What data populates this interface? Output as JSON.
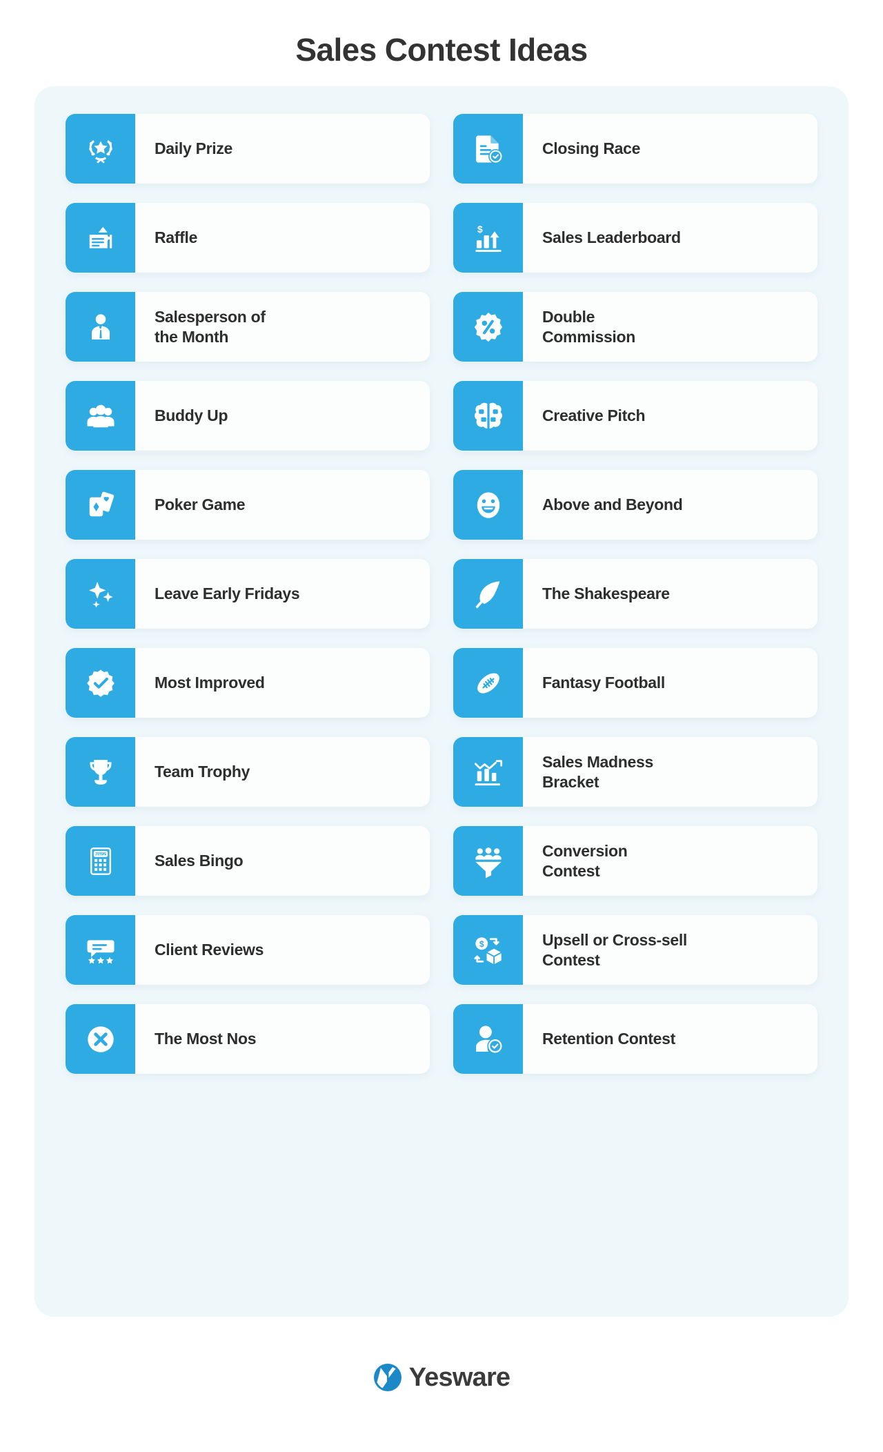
{
  "header": {
    "title": "Sales Contest Ideas"
  },
  "theme": {
    "page_background": "#ffffff",
    "panel_background": "#eef7fa",
    "card_background": "#fcfdfd",
    "icon_tile_color": "#2fabe3",
    "text_color": "#2e2e2e",
    "title_color": "#333333",
    "brand_color": "#1b89c8"
  },
  "panel": {
    "columns": [
      {
        "name": "left-column",
        "cards": [
          {
            "label": "Daily Prize",
            "icon": "laurel-star-icon"
          },
          {
            "label": "Raffle",
            "icon": "raffle-ticket-icon"
          },
          {
            "label": "Salesperson of\nthe Month",
            "icon": "businessperson-icon"
          },
          {
            "label": "Buddy Up",
            "icon": "people-group-icon"
          },
          {
            "label": "Poker Game",
            "icon": "playing-cards-icon"
          },
          {
            "label": "Leave Early Fridays",
            "icon": "sparkles-icon"
          },
          {
            "label": "Most Improved",
            "icon": "badge-check-icon"
          },
          {
            "label": "Team Trophy",
            "icon": "trophy-icon"
          },
          {
            "label": "Sales Bingo",
            "icon": "bingo-card-icon"
          },
          {
            "label": "Client Reviews",
            "icon": "review-stars-icon"
          },
          {
            "label": "The Most Nos",
            "icon": "x-circle-icon"
          }
        ]
      },
      {
        "name": "right-column",
        "cards": [
          {
            "label": "Closing Race",
            "icon": "document-check-icon"
          },
          {
            "label": "Sales Leaderboard",
            "icon": "dollar-bar-chart-icon"
          },
          {
            "label": "Double\nCommission",
            "icon": "percent-badge-icon"
          },
          {
            "label": "Creative Pitch",
            "icon": "brain-puzzle-icon"
          },
          {
            "label": "Above and Beyond",
            "icon": "smiley-face-icon"
          },
          {
            "label": "The Shakespeare",
            "icon": "feather-quill-icon"
          },
          {
            "label": "Fantasy Football",
            "icon": "football-icon"
          },
          {
            "label": "Sales Madness\nBracket",
            "icon": "bar-chart-arrow-icon"
          },
          {
            "label": "Conversion\nContest",
            "icon": "conversion-funnel-icon"
          },
          {
            "label": "Upsell or Cross-sell\nContest",
            "icon": "money-box-exchange-icon"
          },
          {
            "label": "Retention Contest",
            "icon": "person-check-icon"
          }
        ]
      }
    ]
  },
  "footer": {
    "brand_name": "Yesware",
    "logo_icon": "yesware-logo-icon"
  }
}
